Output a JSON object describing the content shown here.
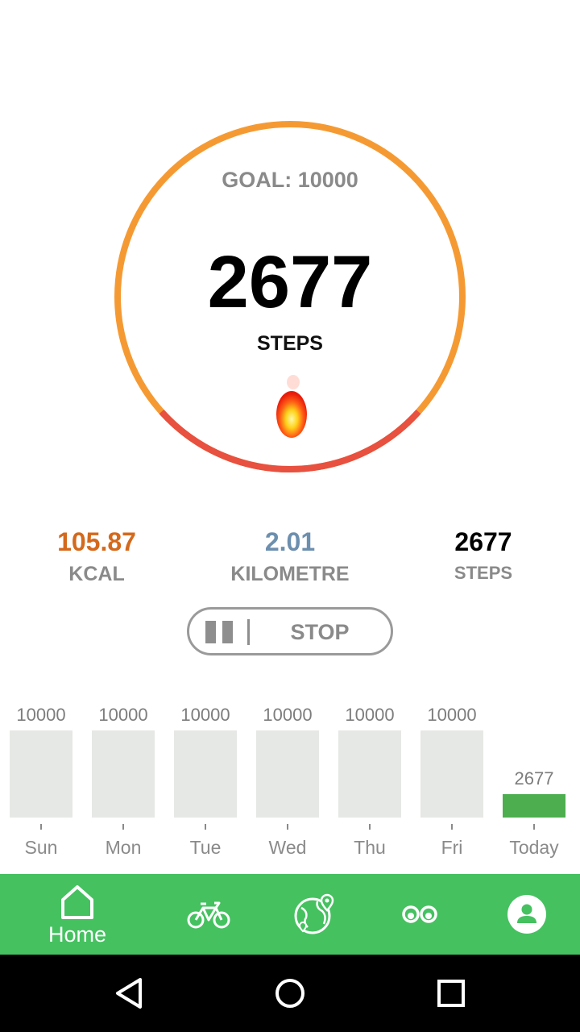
{
  "goal_text": "GOAL: 10000",
  "steps_count": "2677",
  "steps_label": "STEPS",
  "progress_fraction": 0.2677,
  "colors": {
    "ring_main": "#f59a33",
    "ring_progress": "#e8503f",
    "kcal": "#d4691c",
    "km": "#6d8fae",
    "accent_green": "#45c160",
    "bar_today": "#4cae4f",
    "bar_default": "#e6e8e5"
  },
  "stats": {
    "kcal_value": "105.87",
    "kcal_label": "KCAL",
    "km_value": "2.01",
    "km_label": "KILOMETRE",
    "steps_value": "2677",
    "steps_label": "STEPS"
  },
  "control": {
    "pause_icon": "pause-icon",
    "stop_label": "STOP"
  },
  "weekly_bars": [
    {
      "day": "Sun",
      "value": 10000,
      "label": "10000"
    },
    {
      "day": "Mon",
      "value": 10000,
      "label": "10000"
    },
    {
      "day": "Tue",
      "value": 10000,
      "label": "10000"
    },
    {
      "day": "Wed",
      "value": 10000,
      "label": "10000"
    },
    {
      "day": "Thu",
      "value": 10000,
      "label": "10000"
    },
    {
      "day": "Fri",
      "value": 10000,
      "label": "10000"
    },
    {
      "day": "Today",
      "value": 2677,
      "label": "2677"
    }
  ],
  "nav": {
    "home_label": "Home",
    "items": [
      "home-icon",
      "bicycle-icon",
      "globe-map-icon",
      "goggles-icon",
      "profile-icon"
    ]
  },
  "system_nav": [
    "back-icon",
    "home-circle-icon",
    "recents-icon"
  ]
}
